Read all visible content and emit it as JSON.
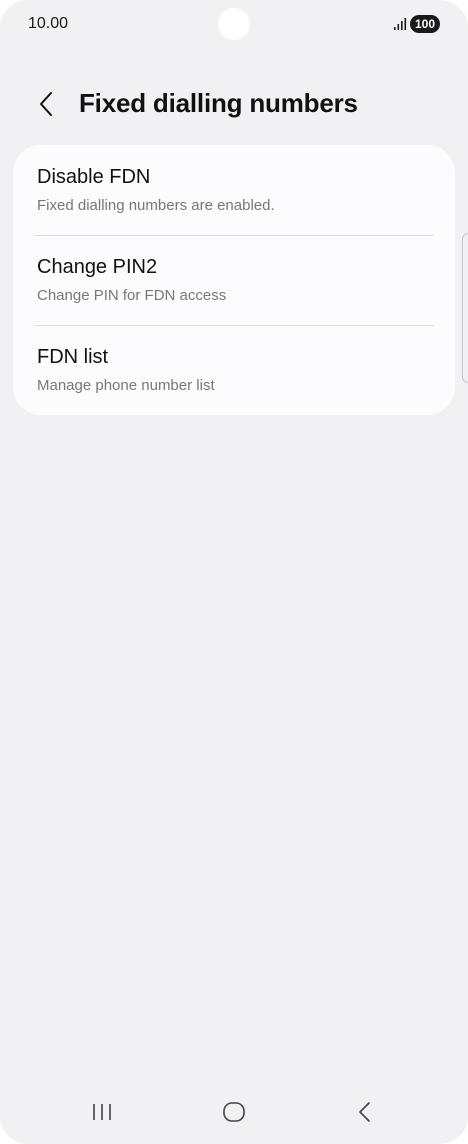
{
  "status_bar": {
    "time": "10.00",
    "battery": "100",
    "signal_icon": "signal-bars-icon"
  },
  "header": {
    "back_icon": "chevron-left-icon",
    "title": "Fixed dialling numbers"
  },
  "settings": {
    "items": [
      {
        "title": "Disable FDN",
        "subtitle": "Fixed dialling numbers are enabled."
      },
      {
        "title": "Change PIN2",
        "subtitle": "Change PIN for FDN access"
      },
      {
        "title": "FDN list",
        "subtitle": "Manage phone number list"
      }
    ]
  },
  "nav_bar": {
    "recents_icon": "recent-apps-icon",
    "home_icon": "home-icon",
    "back_icon": "back-icon"
  },
  "colors": {
    "background": "#f1f1f3",
    "card": "#fcfcfe",
    "text_primary": "#111111",
    "text_secondary": "#777777"
  }
}
